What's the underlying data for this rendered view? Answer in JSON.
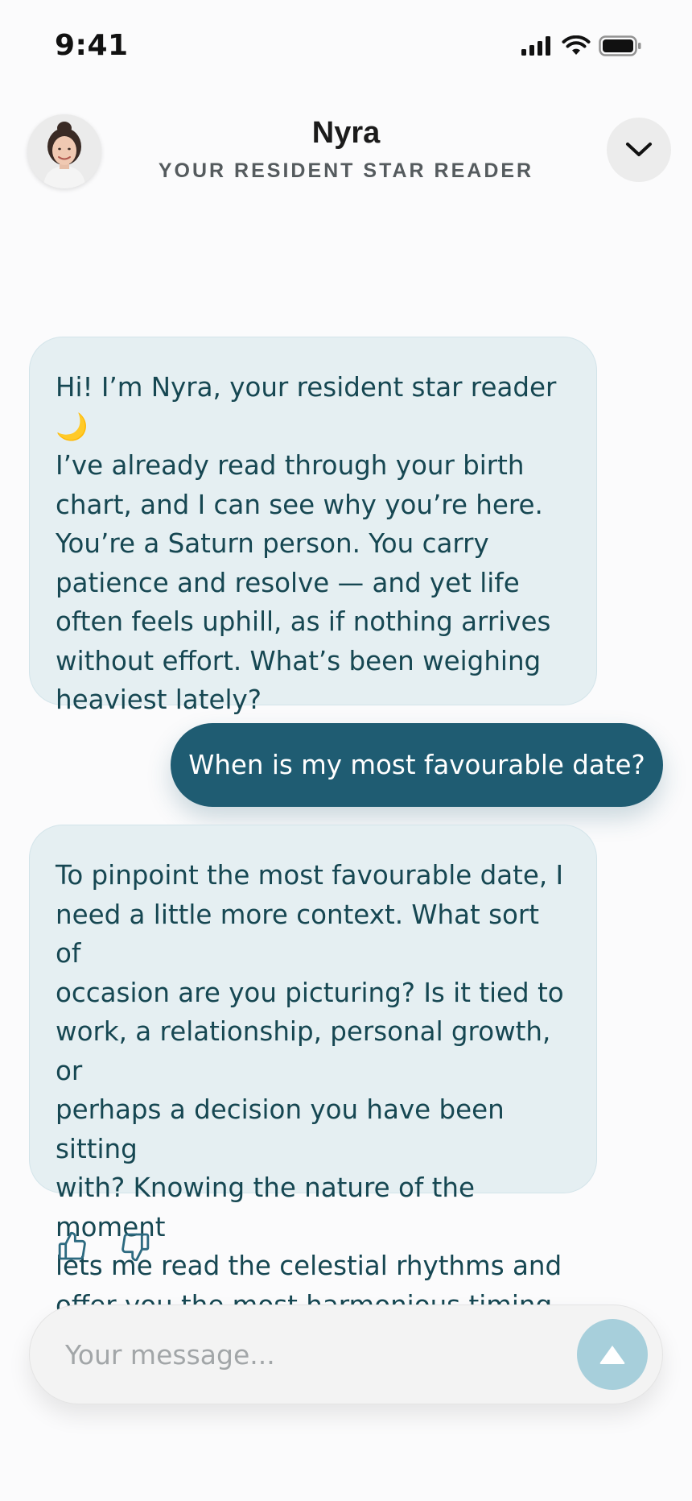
{
  "status_bar": {
    "time": "9:41",
    "icons": [
      "signal-icon",
      "wifi-icon",
      "battery-icon"
    ]
  },
  "header": {
    "title": "Nyra",
    "subtitle": "YOUR RESIDENT STAR READER",
    "avatar": "avatar-photo",
    "collapse_icon": "chevron-down-icon"
  },
  "messages": [
    {
      "sender": "bot",
      "text": "Hi! I’m Nyra, your resident star reader 🌙\nI’ve already read through your birth\nchart, and I can see why you’re here.\nYou’re a Saturn person. You carry\npatience and resolve — and yet life\noften feels uphill, as if nothing arrives\nwithout effort. What’s been weighing\nheaviest lately?"
    },
    {
      "sender": "user",
      "text": "When is my most favourable date?"
    },
    {
      "sender": "bot",
      "text": "To pinpoint the most favourable date, I\nneed a little more context. What sort of\noccasion are you picturing? Is it tied to\nwork, a relationship, personal growth, or\nperhaps a decision you have been sitting\nwith? Knowing the nature of the moment\nlets me read the celestial rhythms and\noffer you the most harmonious timing."
    }
  ],
  "feedback": {
    "like_icon": "thumbs-up-icon",
    "dislike_icon": "thumbs-down-icon"
  },
  "composer": {
    "placeholder": "Your message...",
    "value": "",
    "send_icon": "send-arrow-icon"
  },
  "colors": {
    "accent": "#1f5c72",
    "bot_bubble": "#e5eff2",
    "bot_text": "#164752",
    "send_button": "#a7cfdb",
    "background": "#fbfbfc"
  }
}
